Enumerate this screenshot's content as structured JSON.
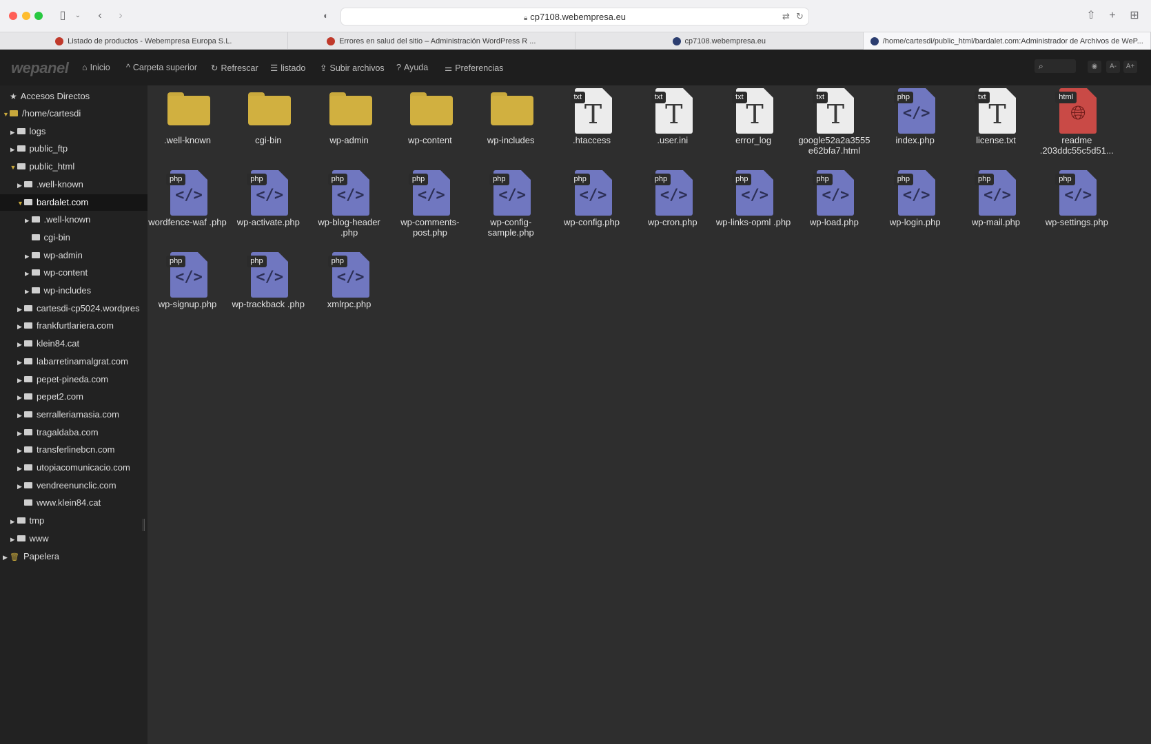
{
  "browser": {
    "url": "cp7108.webempresa.eu",
    "tabs": [
      {
        "label": "Listado de productos - Webempresa Europa S.L.",
        "favicon": "w"
      },
      {
        "label": "Errores en salud del sitio – Administración WordPress R ...",
        "favicon": "w"
      },
      {
        "label": "cp7108.webempresa.eu",
        "favicon": "b"
      },
      {
        "label": "/home/cartesdi/public_html/bardalet.com:Administrador de Archivos de WeP...",
        "favicon": "b"
      }
    ]
  },
  "toolbar": {
    "logo": "wepanel",
    "inicio": "Inicio",
    "carpeta_superior": "Carpeta superior",
    "refrescar": "Refrescar",
    "listado": "listado",
    "subir": "Subir archivos",
    "ayuda": "Ayuda",
    "preferencias": "Preferencias",
    "font_smaller": "A-",
    "font_larger": "A+"
  },
  "sidebar": {
    "accesos": "Accesos Directos",
    "tree": [
      {
        "label": "/home/cartesdi",
        "depth": 0,
        "caret": "open",
        "gold": true
      },
      {
        "label": "logs",
        "depth": 1,
        "caret": "closed"
      },
      {
        "label": "public_ftp",
        "depth": 1,
        "caret": "closed"
      },
      {
        "label": "public_html",
        "depth": 1,
        "caret": "open"
      },
      {
        "label": ".well-known",
        "depth": 2,
        "caret": "closed"
      },
      {
        "label": "bardalet.com",
        "depth": 2,
        "caret": "open",
        "selected": true
      },
      {
        "label": ".well-known",
        "depth": 3,
        "caret": "closed"
      },
      {
        "label": "cgi-bin",
        "depth": 3,
        "caret": "none"
      },
      {
        "label": "wp-admin",
        "depth": 3,
        "caret": "closed"
      },
      {
        "label": "wp-content",
        "depth": 3,
        "caret": "closed"
      },
      {
        "label": "wp-includes",
        "depth": 3,
        "caret": "closed"
      },
      {
        "label": "cartesdi-cp5024.wordpres",
        "depth": 2,
        "caret": "closed"
      },
      {
        "label": "frankfurtlariera.com",
        "depth": 2,
        "caret": "closed"
      },
      {
        "label": "klein84.cat",
        "depth": 2,
        "caret": "closed"
      },
      {
        "label": "labarretinamalgrat.com",
        "depth": 2,
        "caret": "closed"
      },
      {
        "label": "pepet-pineda.com",
        "depth": 2,
        "caret": "closed"
      },
      {
        "label": "pepet2.com",
        "depth": 2,
        "caret": "closed"
      },
      {
        "label": "serralleriamasia.com",
        "depth": 2,
        "caret": "closed"
      },
      {
        "label": "tragaldaba.com",
        "depth": 2,
        "caret": "closed"
      },
      {
        "label": "transferlinebcn.com",
        "depth": 2,
        "caret": "closed"
      },
      {
        "label": "utopiacomunicacio.com",
        "depth": 2,
        "caret": "closed"
      },
      {
        "label": "vendreenunclic.com",
        "depth": 2,
        "caret": "closed"
      },
      {
        "label": "www.klein84.cat",
        "depth": 2,
        "caret": "none"
      },
      {
        "label": "tmp",
        "depth": 1,
        "caret": "closed"
      },
      {
        "label": "www",
        "depth": 1,
        "caret": "closed"
      }
    ],
    "papelera": "Papelera"
  },
  "files": [
    {
      "name": ".well-known",
      "type": "folder"
    },
    {
      "name": "cgi-bin",
      "type": "folder"
    },
    {
      "name": "wp-admin",
      "type": "folder"
    },
    {
      "name": "wp-content",
      "type": "folder"
    },
    {
      "name": "wp-includes",
      "type": "folder"
    },
    {
      "name": ".htaccess",
      "type": "txt"
    },
    {
      "name": ".user.ini",
      "type": "txt"
    },
    {
      "name": "error_log",
      "type": "txt"
    },
    {
      "name": "google52a2a3555 e62bfa7.html",
      "type": "txt"
    },
    {
      "name": "index.php",
      "type": "php"
    },
    {
      "name": "license.txt",
      "type": "txt"
    },
    {
      "name": "readme .203ddc55c5d51...",
      "type": "html"
    },
    {
      "name": "wordfence-waf .php",
      "type": "php"
    },
    {
      "name": "wp-activate.php",
      "type": "php"
    },
    {
      "name": "wp-blog-header .php",
      "type": "php"
    },
    {
      "name": "wp-comments- post.php",
      "type": "php"
    },
    {
      "name": "wp-config- sample.php",
      "type": "php"
    },
    {
      "name": "wp-config.php",
      "type": "php"
    },
    {
      "name": "wp-cron.php",
      "type": "php"
    },
    {
      "name": "wp-links-opml .php",
      "type": "php"
    },
    {
      "name": "wp-load.php",
      "type": "php"
    },
    {
      "name": "wp-login.php",
      "type": "php"
    },
    {
      "name": "wp-mail.php",
      "type": "php"
    },
    {
      "name": "wp-settings.php",
      "type": "php"
    },
    {
      "name": "wp-signup.php",
      "type": "php"
    },
    {
      "name": "wp-trackback .php",
      "type": "php"
    },
    {
      "name": "xmlrpc.php",
      "type": "php"
    }
  ]
}
